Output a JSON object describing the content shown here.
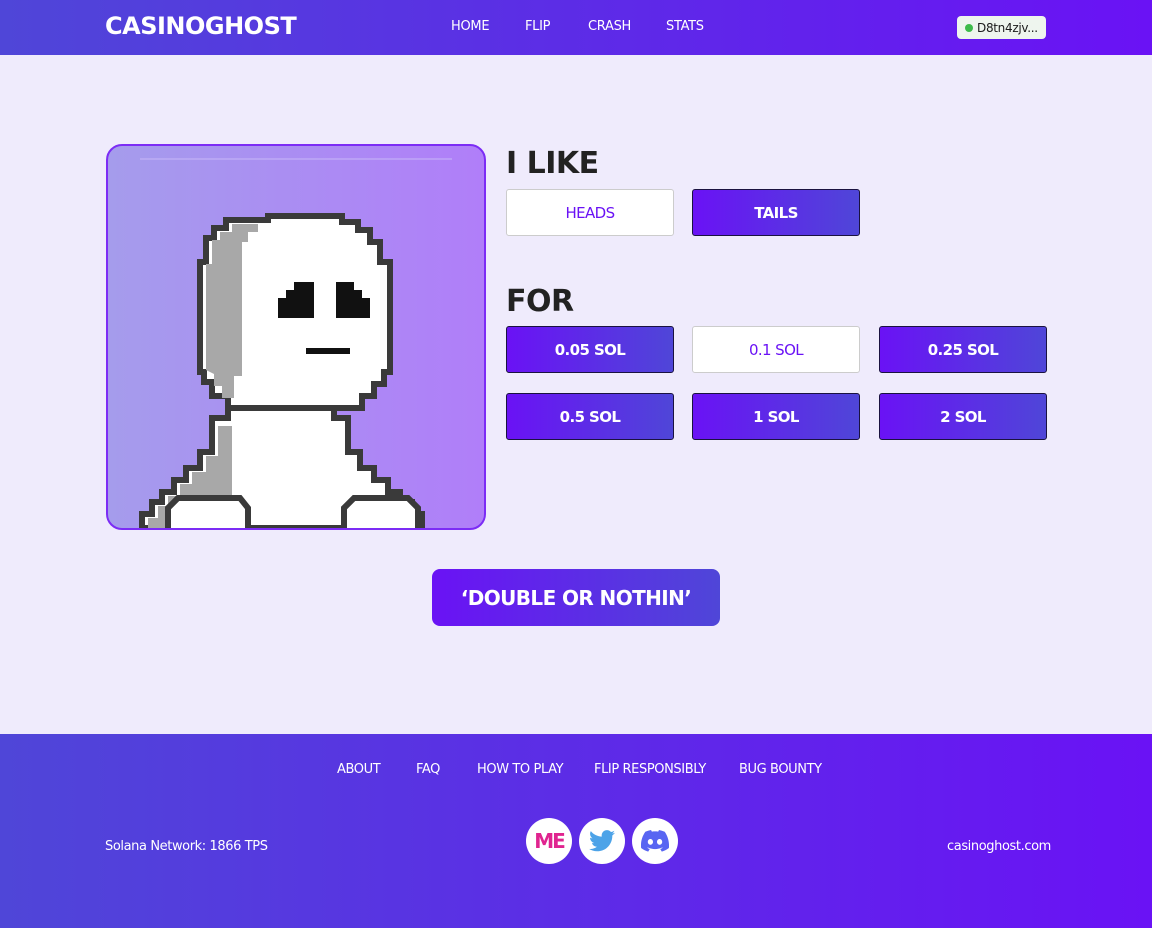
{
  "header": {
    "logo": "CASINOGHOST",
    "nav": [
      "HOME",
      "FLIP",
      "CRASH",
      "STATS"
    ],
    "wallet": "D8tn4zjv..."
  },
  "game": {
    "choice_heading": "I LIKE",
    "choices": [
      {
        "label": "HEADS",
        "selected": false
      },
      {
        "label": "TAILS",
        "selected": true
      }
    ],
    "amount_heading": "FOR",
    "amounts": [
      {
        "label": "0.05 SOL",
        "selected": false
      },
      {
        "label": "0.1 SOL",
        "selected": true
      },
      {
        "label": "0.25 SOL",
        "selected": false
      },
      {
        "label": "0.5 SOL",
        "selected": false
      },
      {
        "label": "1 SOL",
        "selected": false
      },
      {
        "label": "2 SOL",
        "selected": false
      }
    ],
    "cta": "‘DOUBLE OR NOTHIN’"
  },
  "footer": {
    "links": [
      "ABOUT",
      "FAQ",
      "HOW TO PLAY",
      "FLIP RESPONSIBLY",
      "BUG BOUNTY"
    ],
    "network_status": "Solana Network: 1866 TPS",
    "site": "casinoghost.com",
    "socials": [
      {
        "name": "magic-eden-icon",
        "glyph": "ME"
      },
      {
        "name": "twitter-icon"
      },
      {
        "name": "discord-icon"
      }
    ]
  },
  "colors": {
    "accent": "#6a12f5",
    "accent_alt": "#4f46d8",
    "page_bg": "#efebfc",
    "status_online": "#3dbb4a"
  }
}
